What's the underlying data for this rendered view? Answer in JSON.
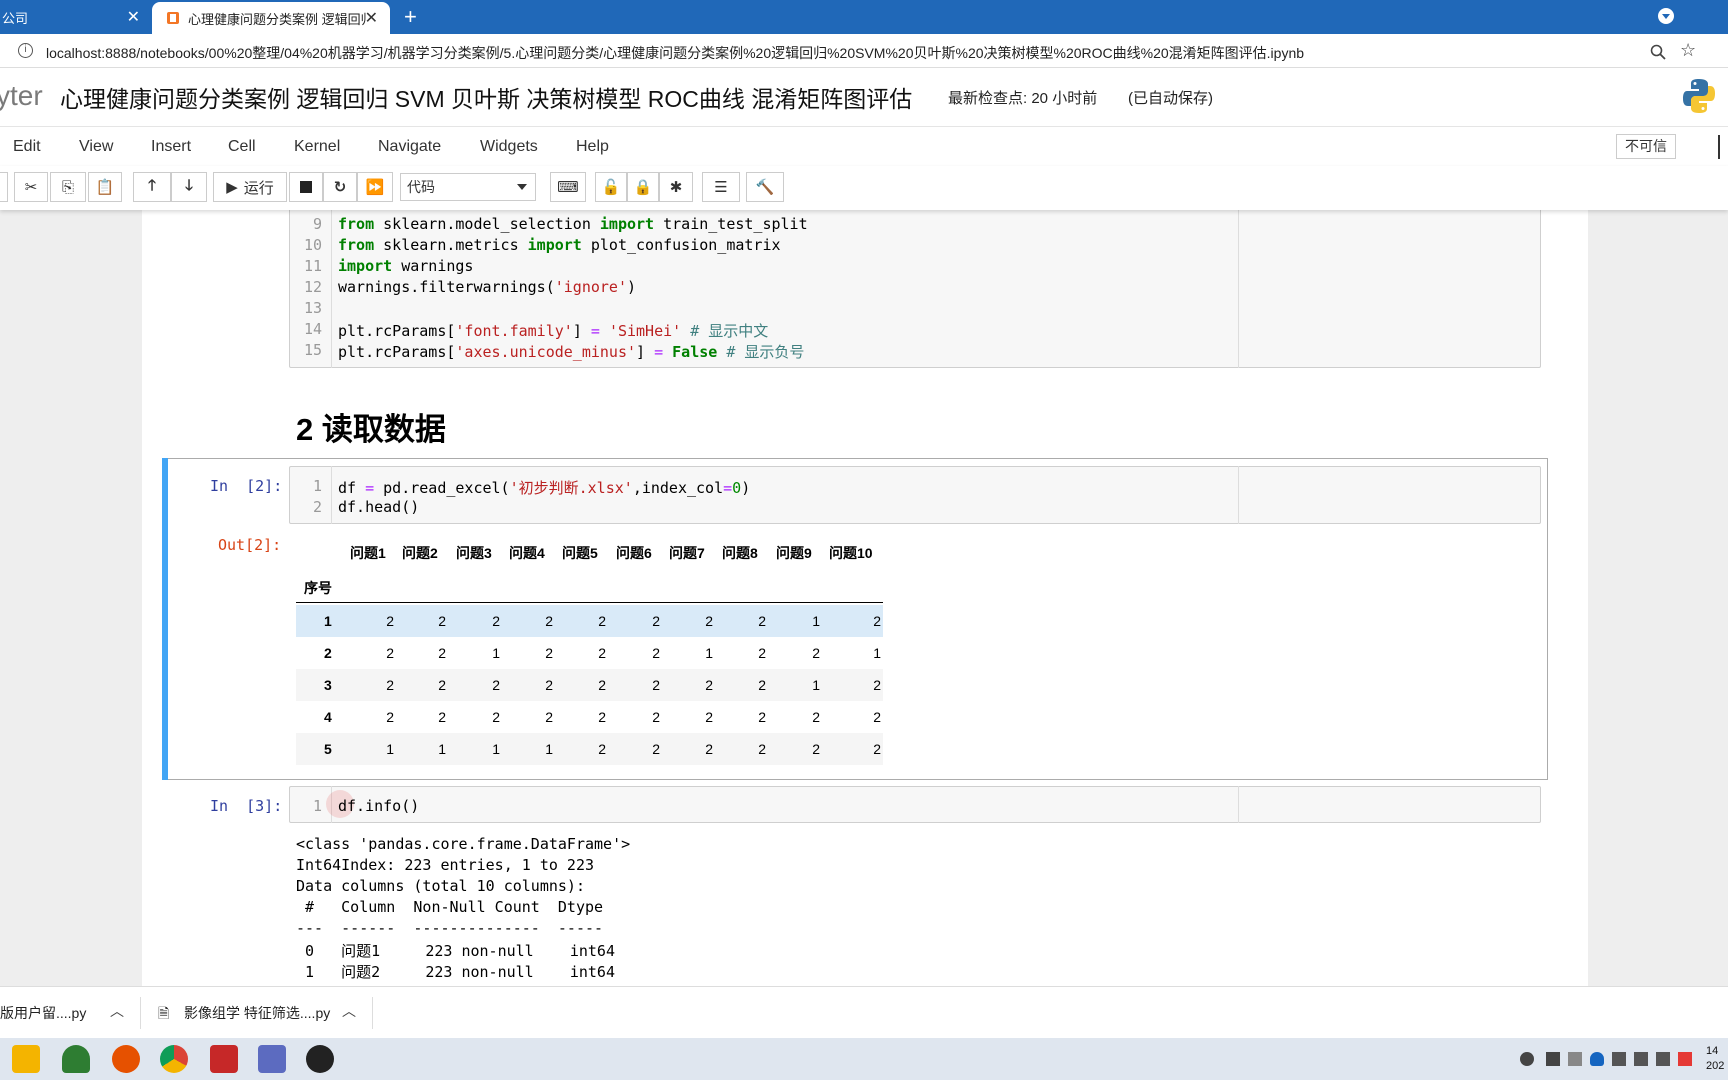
{
  "browser": {
    "tabs": [
      {
        "label": "公司",
        "active": false
      },
      {
        "label": "心理健康问题分类案例 逻辑回归",
        "active": true
      }
    ],
    "url": "localhost:8888/notebooks/00%20整理/04%20机器学习/机器学习分类案例/5.心理问题分类/心理健康问题分类案例%20逻辑回归%20SVM%20贝叶斯%20决策树模型%20ROC曲线%20混淆矩阵图评估.ipynb"
  },
  "jupyter": {
    "logo_text": "yter",
    "title": "心理健康问题分类案例 逻辑回归 SVM 贝叶斯 决策树模型 ROC曲线 混淆矩阵图评估",
    "checkpoint": "最新检查点: 20 小时前",
    "autosave": "(已自动保存)",
    "menu": [
      "Edit",
      "View",
      "Insert",
      "Cell",
      "Kernel",
      "Navigate",
      "Widgets",
      "Help"
    ],
    "trust_label": "不可信",
    "toolbar": {
      "run_label": "运行",
      "cell_type": "代码"
    }
  },
  "cell1": {
    "lines": [
      {
        "no": "9"
      },
      {
        "no": "10"
      },
      {
        "no": "11"
      },
      {
        "no": "12"
      },
      {
        "no": "13"
      },
      {
        "no": "14"
      },
      {
        "no": "15"
      }
    ],
    "code": {
      "l9a": "from",
      "l9b": " sklearn.model_selection ",
      "l9c": "import",
      "l9d": " train_test_split",
      "l10a": "from",
      "l10b": " sklearn.metrics ",
      "l10c": "import",
      "l10d": " plot_confusion_matrix",
      "l11a": "import",
      "l11b": " warnings",
      "l12a": "warnings.filterwarnings(",
      "l12b": "'ignore'",
      "l12c": ")",
      "l14a": "plt.rcParams[",
      "l14b": "'font.family'",
      "l14c": "] ",
      "l14d": "=",
      "l14e": " ",
      "l14f": "'SimHei'",
      "l14g": " ",
      "l14h": "# 显示中文",
      "l15a": "plt.rcParams[",
      "l15b": "'axes.unicode_minus'",
      "l15c": "] ",
      "l15d": "=",
      "l15e": " ",
      "l15f": "False",
      "l15g": " ",
      "l15h": "# 显示负号"
    }
  },
  "heading": "2  读取数据",
  "cell2": {
    "prompt_in": "In  [2]:",
    "prompt_out": "Out[2]:",
    "line1_no": "1",
    "line2_no": "2",
    "l1a": "df ",
    "l1b": "=",
    "l1c": " pd.read_excel(",
    "l1d": "'初步判断.xlsx'",
    "l1e": ",index_col",
    "l1f": "=",
    "l1g": "0",
    "l1h": ")",
    "l2": "df.head()",
    "table": {
      "index_name": "序号",
      "columns": [
        "问题1",
        "问题2",
        "问题3",
        "问题4",
        "问题5",
        "问题6",
        "问题7",
        "问题8",
        "问题9",
        "问题10"
      ],
      "rows": [
        {
          "index": "1",
          "values": [
            "2",
            "2",
            "2",
            "2",
            "2",
            "2",
            "2",
            "2",
            "1",
            "2"
          ]
        },
        {
          "index": "2",
          "values": [
            "2",
            "2",
            "1",
            "2",
            "2",
            "2",
            "1",
            "2",
            "2",
            "1"
          ]
        },
        {
          "index": "3",
          "values": [
            "2",
            "2",
            "2",
            "2",
            "2",
            "2",
            "2",
            "2",
            "1",
            "2"
          ]
        },
        {
          "index": "4",
          "values": [
            "2",
            "2",
            "2",
            "2",
            "2",
            "2",
            "2",
            "2",
            "2",
            "2"
          ]
        },
        {
          "index": "5",
          "values": [
            "1",
            "1",
            "1",
            "1",
            "2",
            "2",
            "2",
            "2",
            "2",
            "2"
          ]
        }
      ]
    }
  },
  "cell3": {
    "prompt_in": "In  [3]:",
    "line1_no": "1",
    "code": "df.info()",
    "output": [
      "<class 'pandas.core.frame.DataFrame'>",
      "Int64Index: 223 entries, 1 to 223",
      "Data columns (total 10 columns):",
      " #   Column  Non-Null Count  Dtype",
      "---  ------  --------------  -----",
      " 0   问题1     223 non-null    int64",
      " 1   问题2     223 non-null    int64"
    ]
  },
  "downloads": [
    {
      "label": "版用户留....py"
    },
    {
      "label": "影像组学 特征筛选....py"
    }
  ],
  "clock": {
    "time": "14",
    "date": "202"
  },
  "colors": {
    "tab_strip": "#2068b8",
    "selected_bar": "#42a5f5",
    "keyword": "#008000",
    "string": "#ba2121",
    "comment": "#408080",
    "prompt_in": "#303f9f",
    "prompt_out": "#d84315"
  }
}
